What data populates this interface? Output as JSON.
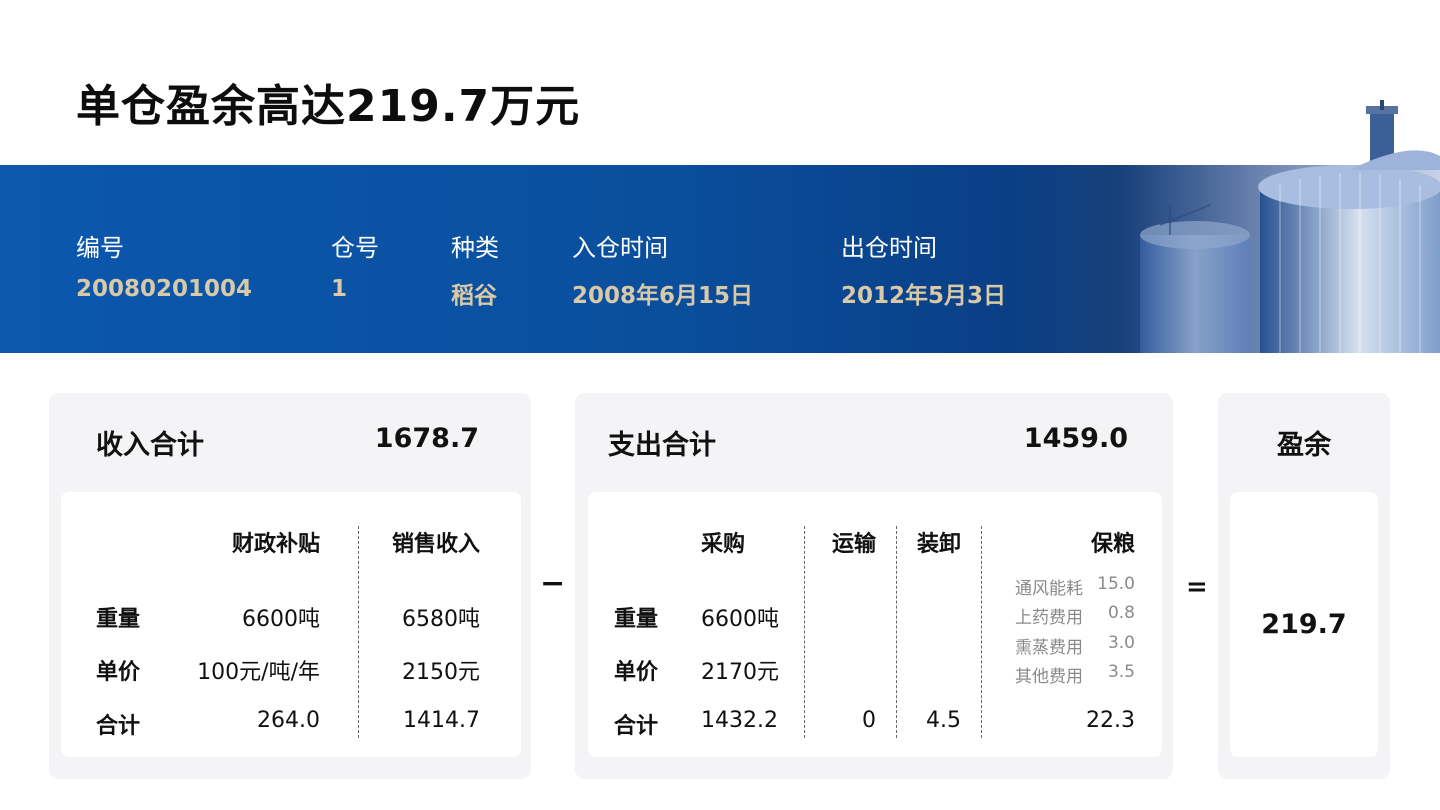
{
  "title": "单仓盈余高达219.7万元",
  "info": {
    "code": {
      "label": "编号",
      "value": "20080201004"
    },
    "bin": {
      "label": "仓号",
      "value": "1"
    },
    "kind": {
      "label": "种类",
      "value": "稻谷"
    },
    "in_time": {
      "label": "入仓时间",
      "value": "2008年6月15日"
    },
    "out_time": {
      "label": "出仓时间",
      "value": "2012年5月3日"
    }
  },
  "income": {
    "title": "收入合计",
    "total": "1678.7",
    "columns": [
      "财政补贴",
      "销售收入"
    ],
    "rows": [
      {
        "label": "重量",
        "values": [
          "6600吨",
          "6580吨"
        ]
      },
      {
        "label": "单价",
        "values": [
          "100元/吨/年",
          "2150元"
        ]
      },
      {
        "label": "合计",
        "values": [
          "264.0",
          "1414.7"
        ]
      }
    ]
  },
  "expense": {
    "title": "支出合计",
    "total": "1459.0",
    "columns": [
      "采购",
      "运输",
      "装卸",
      "保粮"
    ],
    "rows": [
      {
        "label": "重量",
        "values": [
          "6600吨"
        ]
      },
      {
        "label": "单价",
        "values": [
          "2170元"
        ]
      },
      {
        "label": "合计",
        "values": [
          "1432.2",
          "0",
          "4.5",
          "22.3"
        ]
      }
    ],
    "storage_items": [
      {
        "name": "通风能耗",
        "value": "15.0"
      },
      {
        "name": "上药费用",
        "value": "0.8"
      },
      {
        "name": "熏蒸费用",
        "value": "3.0"
      },
      {
        "name": "其他费用",
        "value": "3.5"
      }
    ]
  },
  "surplus": {
    "title": "盈余",
    "value": "219.7"
  },
  "operators": {
    "minus": "−",
    "equals": "="
  },
  "colors": {
    "banner": "#0b58ad",
    "gold": "#d9c9a6",
    "panel_bg": "#f4f4f6"
  }
}
